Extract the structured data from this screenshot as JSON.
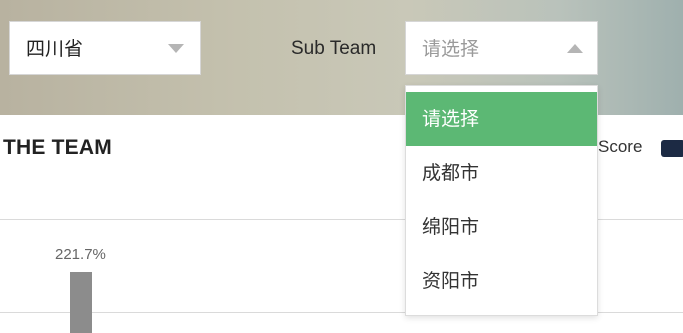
{
  "province_select": {
    "value": "四川省"
  },
  "subteam": {
    "label": "Sub Team",
    "placeholder": "请选择",
    "options": [
      "请选择",
      "成都市",
      "绵阳市",
      "资阳市"
    ],
    "selected_index": 0
  },
  "section": {
    "title": "THE TEAM",
    "legend_label": "Score"
  },
  "chart_data": {
    "type": "bar",
    "values": [
      221.7
    ],
    "data_labels": [
      "221.7%"
    ]
  },
  "colors": {
    "selected_option": "#5cb874",
    "legend_swatch": "#1c2a44",
    "bar": "#8c8c8c"
  }
}
